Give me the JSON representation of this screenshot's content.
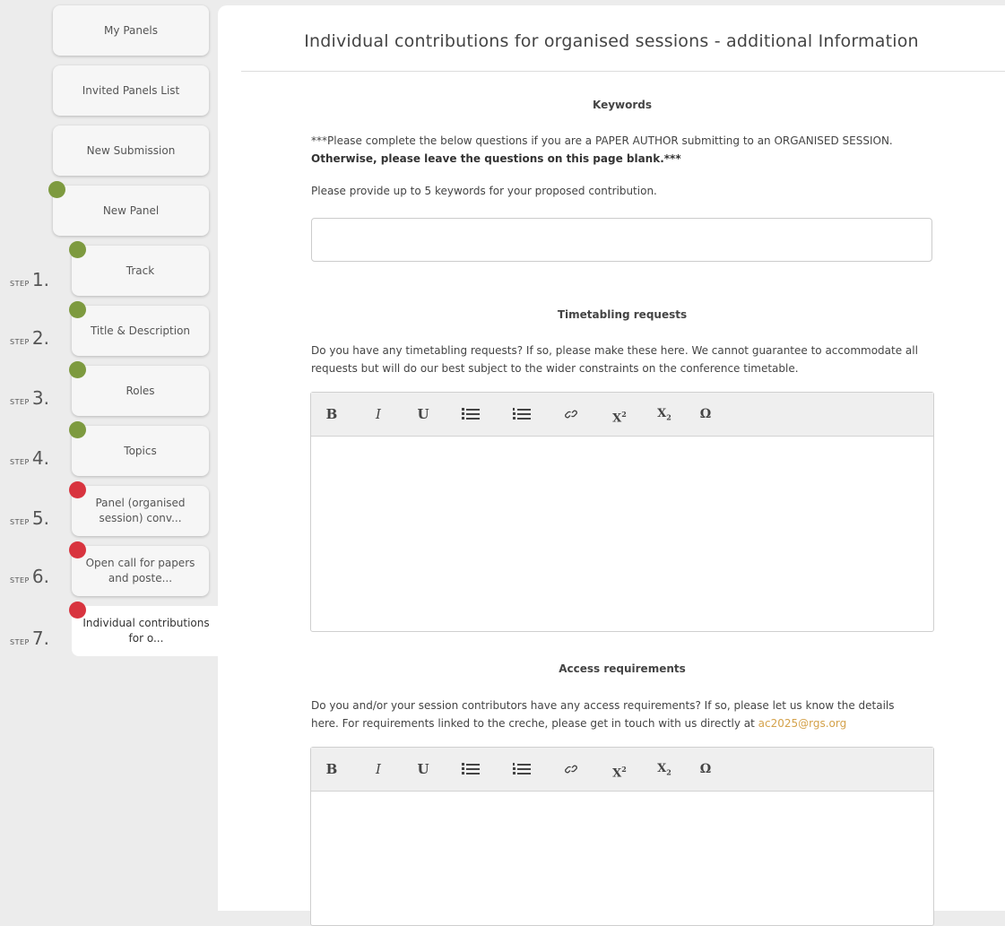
{
  "sidebar": {
    "nav": [
      {
        "label": "My Panels"
      },
      {
        "label": "Invited Panels List"
      },
      {
        "label": "New Submission"
      },
      {
        "label": "New Panel"
      }
    ],
    "step_word": "STEP",
    "steps": [
      {
        "num": "1.",
        "label": "Track",
        "status": "complete"
      },
      {
        "num": "2.",
        "label": "Title & Description",
        "status": "complete"
      },
      {
        "num": "3.",
        "label": "Roles",
        "status": "complete"
      },
      {
        "num": "4.",
        "label": "Topics",
        "status": "complete"
      },
      {
        "num": "5.",
        "label": "Panel (organised session) conv...",
        "status": "incomplete"
      },
      {
        "num": "6.",
        "label": "Open call for papers and poste...",
        "status": "incomplete"
      },
      {
        "num": "7.",
        "label": "Individual contributions for o...",
        "status": "incomplete",
        "active": true
      }
    ],
    "colors": {
      "complete": "#7d9a3f",
      "incomplete": "#d8343f"
    }
  },
  "main": {
    "title": "Individual contributions for organised sessions - additional Information",
    "keywords": {
      "heading": "Keywords",
      "intro_line1": "***Please complete the below questions if you are a PAPER AUTHOR submitting to an ORGANISED SESSION.",
      "intro_line2": "Otherwise, please leave the questions on this page blank.***",
      "prompt": "Please provide up to 5 keywords for your proposed contribution.",
      "value": ""
    },
    "timetabling": {
      "heading": "Timetabling requests",
      "line1": "Do you have any timetabling requests? If so, please make these here. We cannot guarantee to accommodate all",
      "line2": "requests but will do our best subject to the wider constraints on the conference timetable.",
      "value": ""
    },
    "access": {
      "heading": "Access requirements",
      "line1": "Do you and/or your session contributors have any access requirements? If so, please let us know the details",
      "line2_prefix": "here. For requirements linked to the creche, please get in touch with us directly at ",
      "email": "ac2025@rgs.org",
      "value": ""
    },
    "toolbar": {
      "bold": "B",
      "italic": "I",
      "underline": "U",
      "superscript": "X",
      "superscript_mark": "2",
      "subscript": "X",
      "subscript_mark": "2",
      "omega": "Ω"
    }
  }
}
